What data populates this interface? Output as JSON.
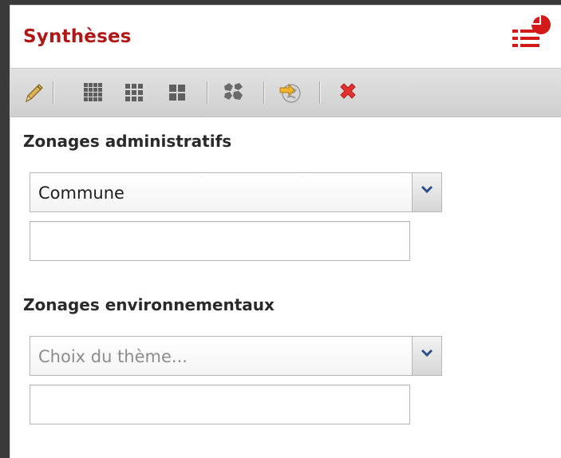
{
  "panel": {
    "title": "Synthèses",
    "header_icon": "list-pie-chart-icon"
  },
  "toolbar": {
    "buttons": [
      {
        "name": "edit-button",
        "icon": "pencil-icon"
      },
      {
        "name": "grid-fine-button",
        "icon": "grid-fine-icon"
      },
      {
        "name": "grid-medium-button",
        "icon": "grid-medium-icon"
      },
      {
        "name": "grid-large-button",
        "icon": "grid-large-icon"
      },
      {
        "name": "cluster-button",
        "icon": "polygons-icon"
      },
      {
        "name": "geolocate-button",
        "icon": "globe-pointer-icon"
      },
      {
        "name": "delete-button",
        "icon": "red-cross-icon"
      }
    ]
  },
  "admin": {
    "label": "Zonages administratifs",
    "select_value": "Commune",
    "input_value": ""
  },
  "env": {
    "label": "Zonages environnementaux",
    "select_placeholder": "Choix du thème...",
    "input_value": ""
  },
  "colors": {
    "title": "#b01818",
    "background_outer": "#3a3a3a",
    "toolbar": "#d9d9d9",
    "delete": "#e23030"
  }
}
